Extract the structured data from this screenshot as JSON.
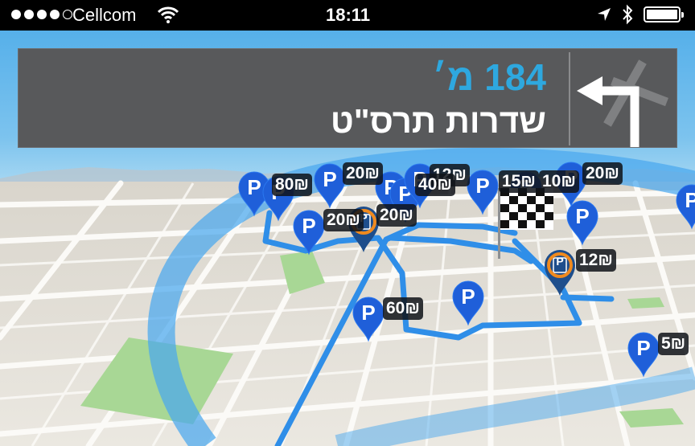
{
  "status_bar": {
    "signal_filled": 4,
    "signal_total": 5,
    "carrier": "Cellcom",
    "time": "18:11"
  },
  "navigation": {
    "distance": "184 מ׳",
    "street": "שדרות תרס\"ט",
    "maneuver_icon": "turn-left-arrow"
  },
  "parking": {
    "pin_letter": "P",
    "lot_letter": "P",
    "prices": [
      "80₪",
      "20₪",
      "12₪",
      "20₪",
      "40₪",
      "15₪",
      "10₪",
      "20₪",
      "20₪",
      "20₪",
      "12₪",
      "60₪",
      "5₪"
    ]
  },
  "colors": {
    "route": "#2f8ee8",
    "pin_blue": "#1f5fd9",
    "lot_pin": "#1e4e8c",
    "lot_ring": "#f08a1e",
    "banner_bg": "#58595b",
    "distance_text": "#2ea8df"
  }
}
